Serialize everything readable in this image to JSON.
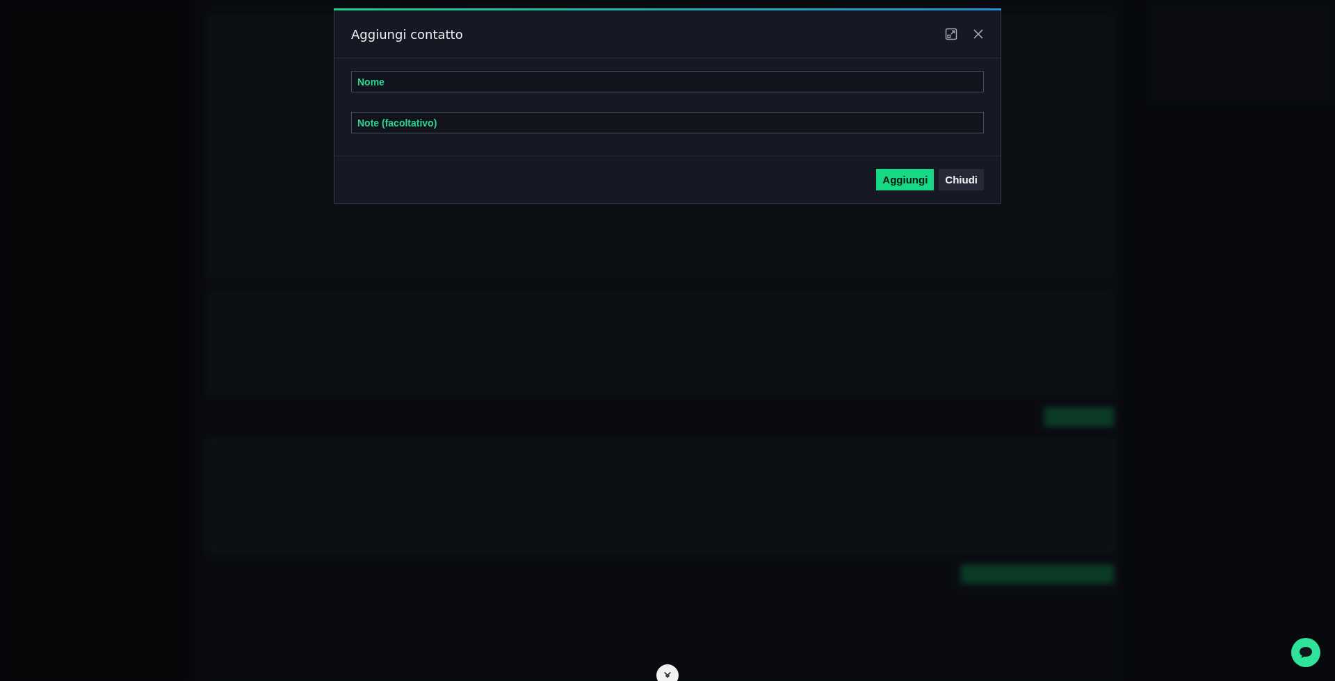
{
  "dialog": {
    "title": "Aggiungi contatto",
    "fields": [
      {
        "placeholder": "Nome"
      },
      {
        "placeholder": "Note (facoltativo)"
      }
    ],
    "buttons": [
      {
        "label": "Aggiungi",
        "kind": "primary"
      },
      {
        "label": "Chiudi",
        "kind": "secondary"
      }
    ]
  }
}
